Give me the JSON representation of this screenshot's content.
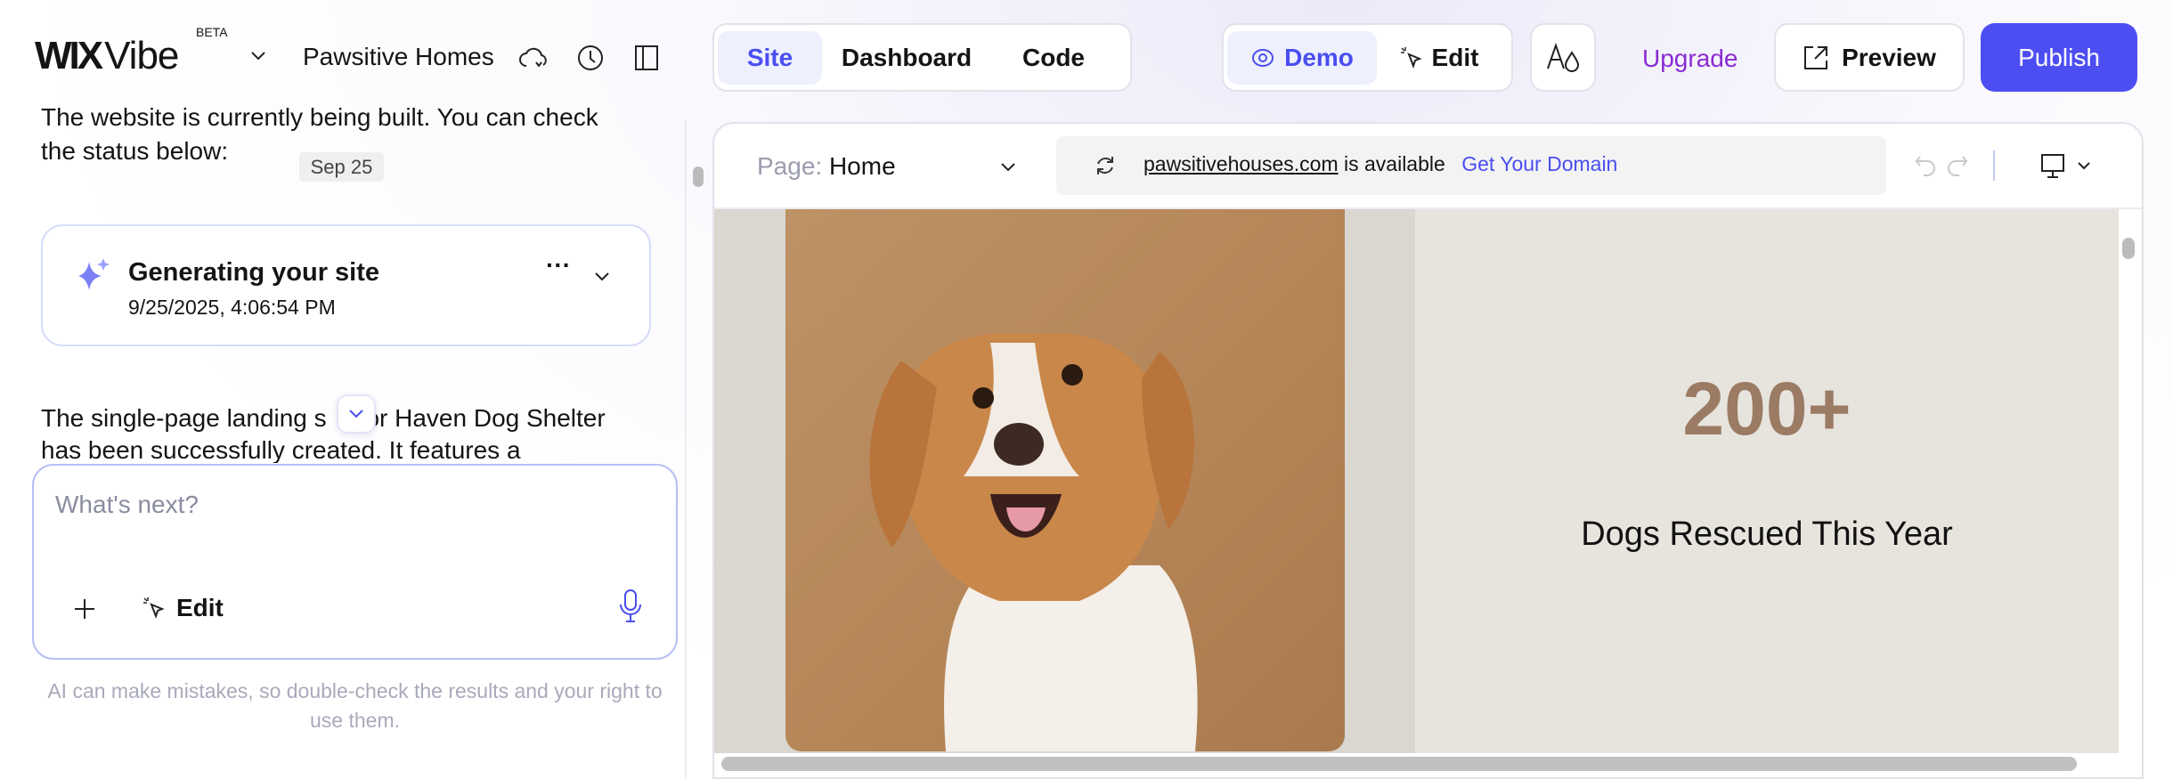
{
  "header": {
    "logo": {
      "brand": "WIX",
      "product": "Vibe",
      "badge": "BETA"
    },
    "site_name": "Pawsitive Homes",
    "view_tabs": [
      {
        "label": "Site",
        "active": true
      },
      {
        "label": "Dashboard",
        "active": false
      },
      {
        "label": "Code",
        "active": false
      }
    ],
    "mode_tabs": [
      {
        "label": "Demo",
        "icon": "eye-icon",
        "active": true
      },
      {
        "label": "Edit",
        "icon": "cursor-click-icon",
        "active": false
      }
    ],
    "theme_icon": "font-color-icon",
    "upgrade_label": "Upgrade",
    "preview_label": "Preview",
    "publish_label": "Publish",
    "colors": {
      "accent": "#4d4ef2",
      "upgrade": "#8a2bd1"
    }
  },
  "chat": {
    "message_1_line_1": "The website is currently being built. You can check",
    "message_1_line_2": "the status below:",
    "date_badge": "Sep 25",
    "status_card": {
      "title": "Generating your site",
      "timestamp": "9/25/2025, 4:06:54 PM",
      "icon": "sparkle-icon"
    },
    "message_2_line_1_a": "The single-page landing s",
    "message_2_line_1_b": "for Haven Dog Shelter",
    "message_2_line_2": "has been successfully created. It features a",
    "input": {
      "placeholder": "What's next?",
      "edit_label": "Edit"
    },
    "disclaimer": "AI can make mistakes, so double-check the results and your right to use them."
  },
  "preview": {
    "page_label": "Page:",
    "page_value": "Home",
    "domain": "pawsitivehouses.com",
    "domain_status": "is available",
    "domain_cta": "Get Your Domain",
    "stat_value": "200+",
    "stat_label": "Dogs Rescued This Year",
    "colors": {
      "stat": "#9b7b63",
      "left_bg": "#dad6d0",
      "right_bg": "#e7e4de"
    }
  }
}
